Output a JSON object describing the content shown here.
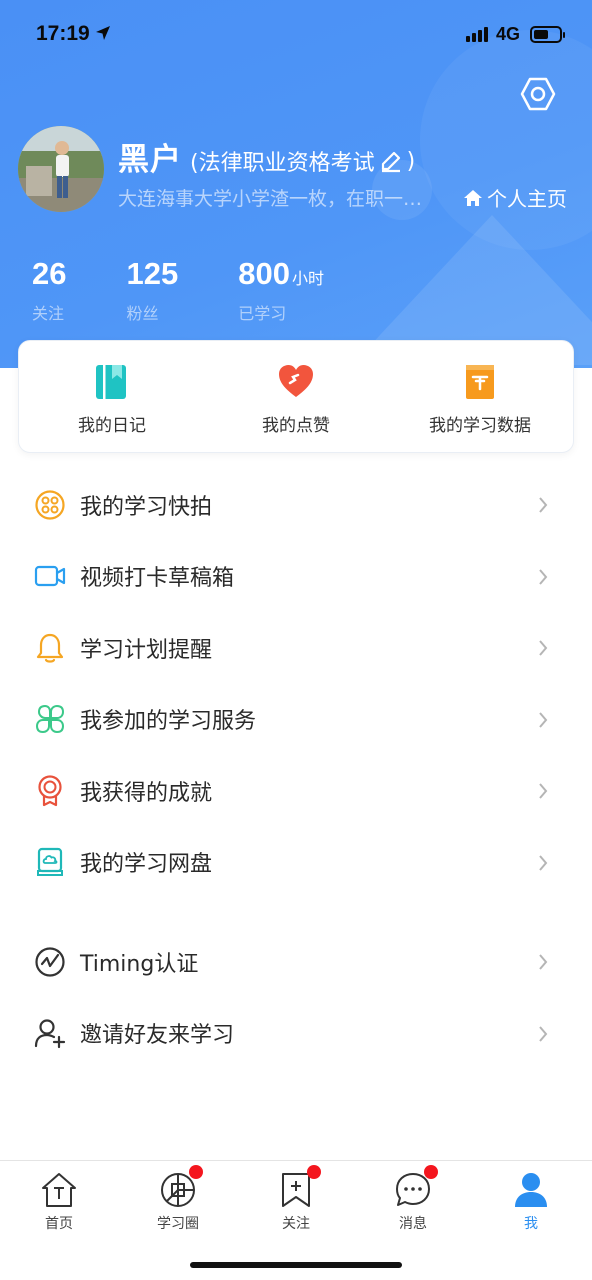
{
  "status_bar": {
    "time": "17:19",
    "network": "4G",
    "battery_level": 0.6
  },
  "profile": {
    "name": "黑户",
    "exam_open": "(法律职业资格考试",
    "exam_close": ")",
    "bio": "大连海事大学小学渣一枚，在职一…",
    "homepage_label": "个人主页"
  },
  "stats": [
    {
      "value": "26",
      "unit": "",
      "label": "关注"
    },
    {
      "value": "125",
      "unit": "",
      "label": "粉丝"
    },
    {
      "value": "800",
      "unit": "小时",
      "label": "已学习"
    }
  ],
  "quick_actions": [
    {
      "label": "我的日记",
      "icon": "diary-book-icon",
      "color": "#1fc3c3"
    },
    {
      "label": "我的点赞",
      "icon": "heart-icon",
      "color": "#f2553d"
    },
    {
      "label": "我的学习数据",
      "icon": "data-folder-icon",
      "color": "#f79a1d"
    }
  ],
  "menu": [
    {
      "label": "我的学习快拍",
      "icon": "film-reel-icon",
      "color": "#f5a623"
    },
    {
      "label": "视频打卡草稿箱",
      "icon": "video-camera-icon",
      "color": "#2a9ff0"
    },
    {
      "label": "学习计划提醒",
      "icon": "bell-icon",
      "color": "#f5a623"
    },
    {
      "label": "我参加的学习服务",
      "icon": "clover-icon",
      "color": "#3cc98a"
    },
    {
      "label": "我获得的成就",
      "icon": "medal-icon",
      "color": "#e8523c"
    },
    {
      "label": "我的学习网盘",
      "icon": "cloud-disk-icon",
      "color": "#1fb8b8"
    },
    {
      "label": "Timing认证",
      "icon": "timing-check-icon",
      "color": "#333333"
    },
    {
      "label": "邀请好友来学习",
      "icon": "add-friend-icon",
      "color": "#333333"
    }
  ],
  "tabs": [
    {
      "label": "首页",
      "icon": "home-icon",
      "badge": false
    },
    {
      "label": "学习圈",
      "icon": "study-circle-icon",
      "badge": true
    },
    {
      "label": "关注",
      "icon": "follow-bookmark-icon",
      "badge": true
    },
    {
      "label": "消息",
      "icon": "message-icon",
      "badge": true
    },
    {
      "label": "我",
      "icon": "me-icon",
      "badge": false,
      "active": true
    }
  ],
  "colors": {
    "brand_blue": "#4a90f5",
    "active_tab": "#2a8ef0",
    "badge_red": "#f4161e"
  }
}
